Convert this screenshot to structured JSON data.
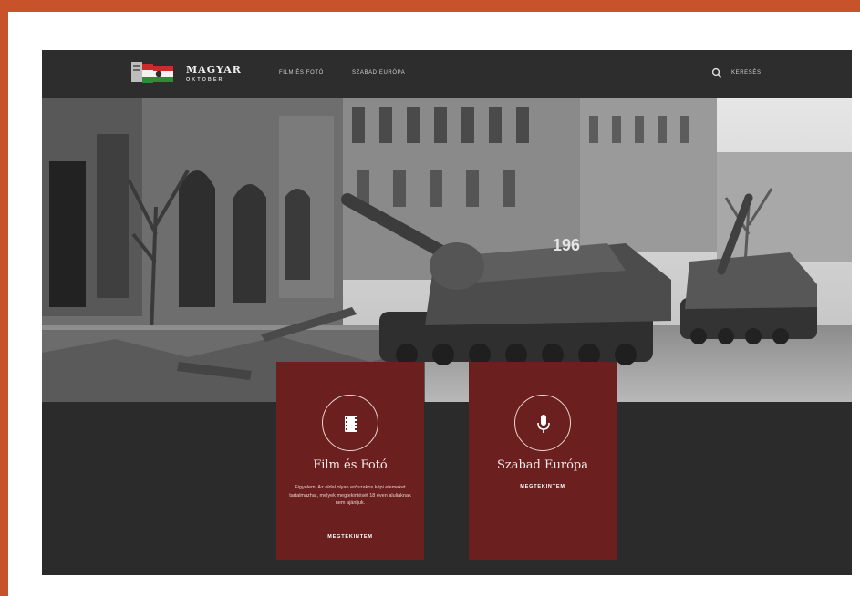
{
  "header": {
    "logo_title": "MAGYAR",
    "logo_subtitle": "OKTÓBER",
    "nav": [
      "FILM ÉS FOTÓ",
      "SZABAD EURÓPA"
    ],
    "search_label": "KERESÉS"
  },
  "hero": {
    "tank_number": "196"
  },
  "cards": [
    {
      "title": "Film és Fotó",
      "description": "Figyelem! Az oldal olyan erőszakos képi elemeket tartalmazhat, melyek megtekintését 18 éven aluliaknak nem ajánljuk.",
      "link": "MEGTEKINTEM",
      "icon": "film-icon"
    },
    {
      "title": "Szabad Európa",
      "link": "MEGTEKINTEM",
      "icon": "microphone-icon"
    }
  ],
  "colors": {
    "frame": "#c8522a",
    "card": "#6b1f1e",
    "header": "#2d2d2d"
  }
}
